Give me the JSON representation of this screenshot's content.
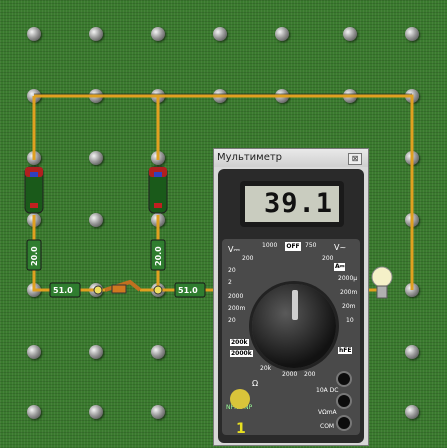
{
  "multimeter": {
    "title": "Мультиметр",
    "close_label": "⊠",
    "reading": "39.1",
    "dial": {
      "off": "OFF",
      "v_dc": "V⎓",
      "v_ac": "V~",
      "a_label": "A⎓",
      "ohm_label": "Ω",
      "hfe": "hFE",
      "npn_pnp": "NPN PNP",
      "ranges_v_dc": [
        "1000",
        "200",
        "20",
        "2"
      ],
      "ranges_v_ac": [
        "750",
        "200"
      ],
      "ranges_a": [
        "2000μ",
        "200m",
        "20m",
        "10"
      ],
      "ranges_ohm": [
        "200",
        "2000",
        "20k",
        "200k",
        "2000k"
      ],
      "ranges_left": [
        "2000",
        "200m",
        "20",
        "200"
      ]
    },
    "jacks": {
      "ten_a": "10A DC",
      "v_ohm_ma": "VΩmA",
      "com": "COM"
    },
    "probe_number": "1"
  },
  "circuit": {
    "battery_1_label": "",
    "resistor_labels": [
      "20.0",
      "20.0",
      "51.0",
      "51.0"
    ],
    "switch_state": "open",
    "bulb": "lightbulb-icon"
  },
  "colors": {
    "board": "#3a7a2e",
    "wire": "#e0a020",
    "multimeter_body": "#2a2a2a"
  }
}
